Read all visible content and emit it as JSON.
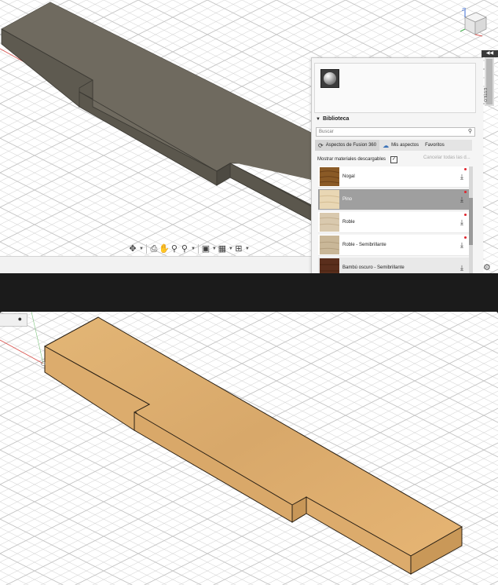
{
  "top_viewport": {
    "model_color": "#6f6a5f",
    "viewcube_axes": {
      "z": "Z",
      "y": "Y",
      "x": "X"
    },
    "nav_toolbar": {
      "icons": [
        "orbit-icon",
        "look-at-icon",
        "pan-icon",
        "zoom-icon",
        "zoom-window-icon",
        "display-settings-icon",
        "grid-settings-icon",
        "viewports-icon"
      ]
    }
  },
  "appearance_panel": {
    "side_label": "ESTILO",
    "library_label": "Biblioteca",
    "search_placeholder": "Buscar",
    "tabs": [
      {
        "label": "Aspectos de Fusion 360",
        "icon": "refresh-icon"
      },
      {
        "label": "Mis aspectos",
        "icon": "cloud-icon"
      },
      {
        "label": "Favoritos",
        "icon": ""
      }
    ],
    "show_downloadable_label": "Mostrar materiales descargables",
    "show_downloadable_checked": true,
    "cancel_all_label": "Cancelar todas las d...",
    "materials": [
      {
        "name": "Nogal",
        "color": "#8a5a26",
        "state": "normal"
      },
      {
        "name": "Pino",
        "color": "#e9d7b4",
        "state": "selected"
      },
      {
        "name": "Roble",
        "color": "#d9c9ae",
        "state": "normal"
      },
      {
        "name": "Roble - Semibrillante",
        "color": "#c9b798",
        "state": "normal"
      },
      {
        "name": "Bambú oscuro - Semibrillante",
        "color": "#5a2e1c",
        "state": "hover"
      }
    ],
    "accent_red": "#e0262f"
  },
  "bottom_viewport": {
    "model_color": "#dfae6f"
  }
}
